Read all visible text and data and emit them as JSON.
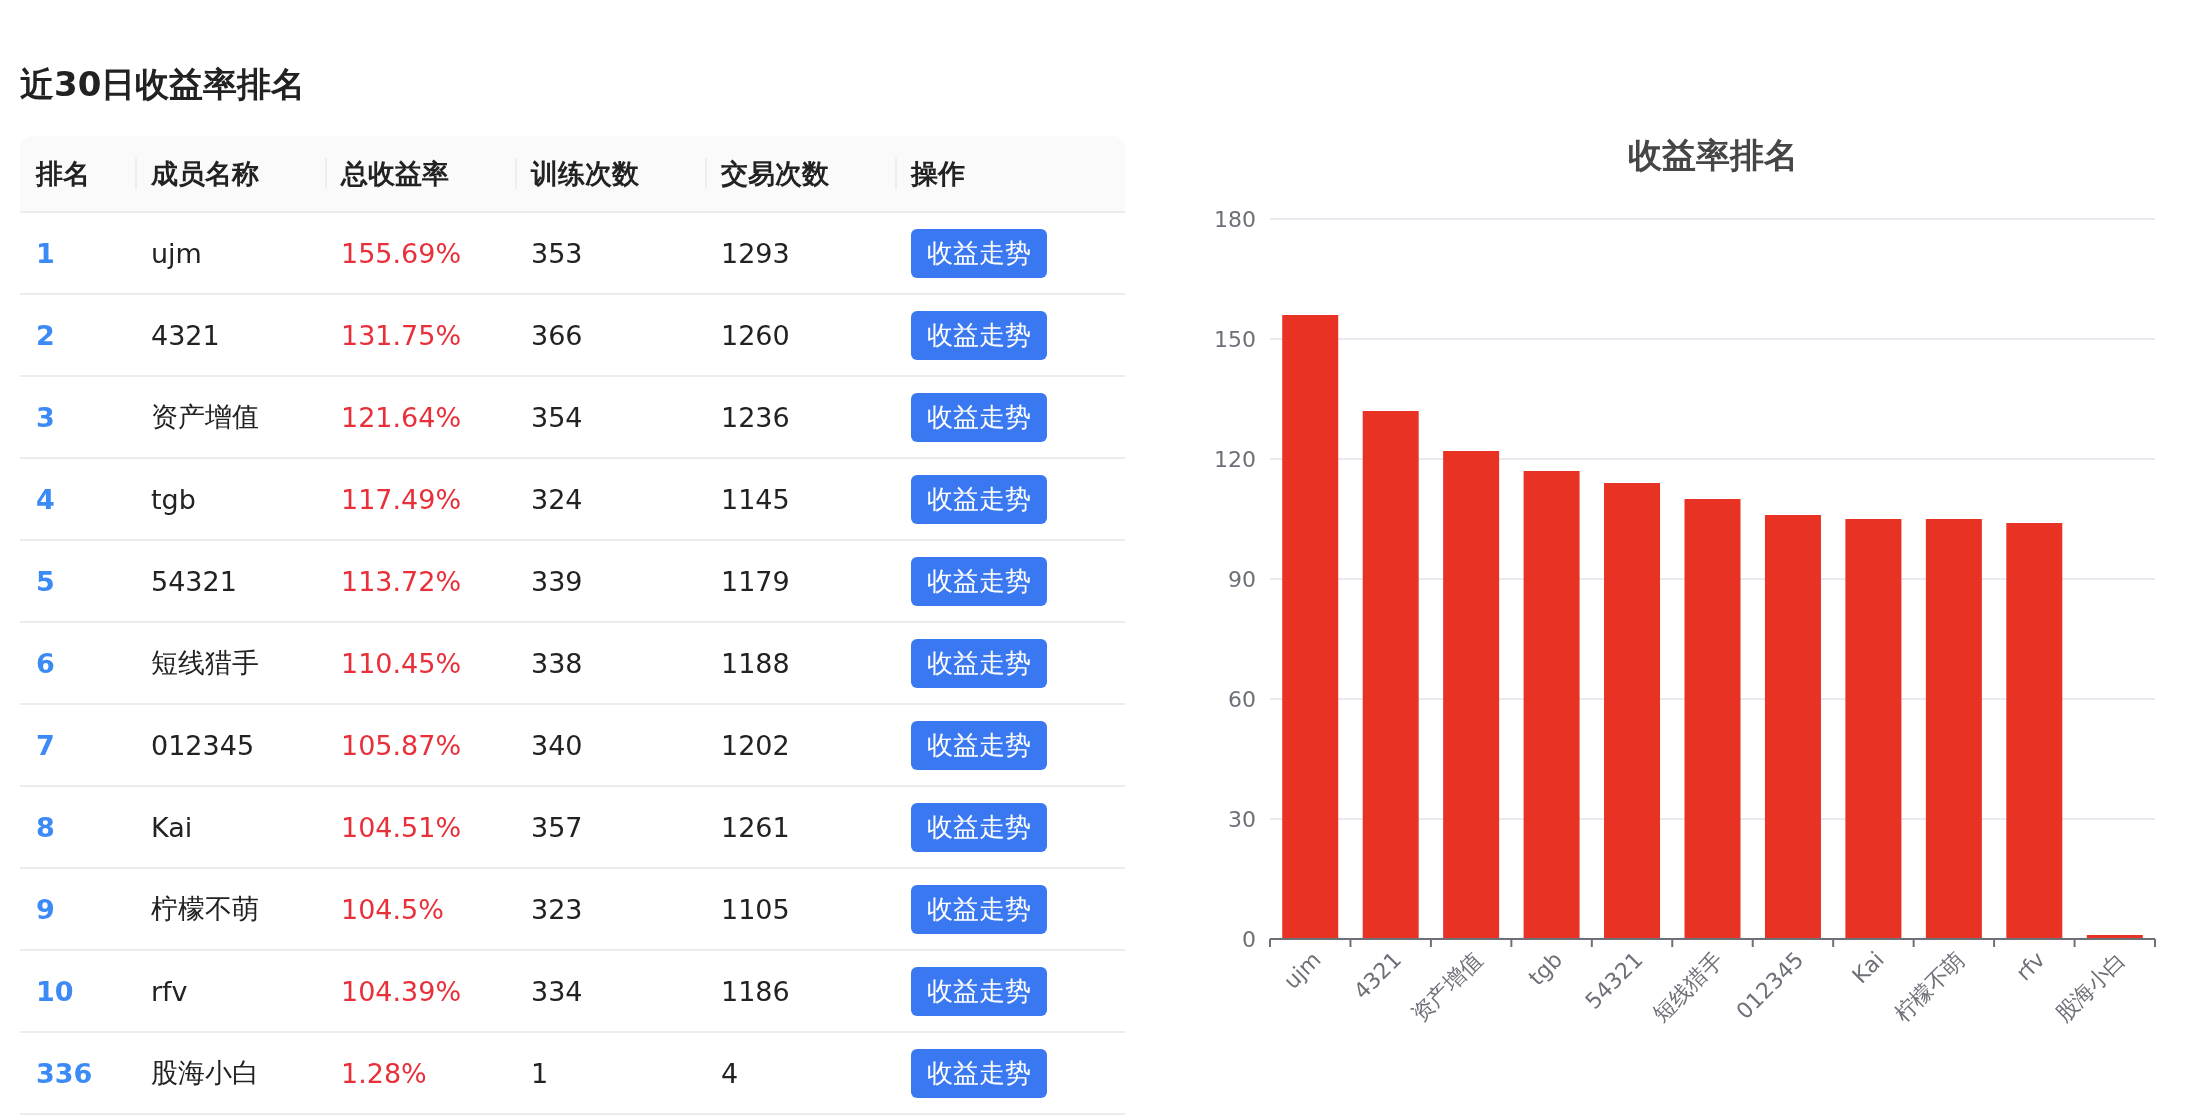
{
  "title": "近30日收益率排名",
  "table": {
    "columns": [
      "排名",
      "成员名称",
      "总收益率",
      "训练次数",
      "交易次数",
      "操作"
    ],
    "rows": [
      {
        "rank": "1",
        "name": "ujm",
        "rate": "155.69%",
        "training": "353",
        "trades": "1293",
        "action": "收益走势"
      },
      {
        "rank": "2",
        "name": "4321",
        "rate": "131.75%",
        "training": "366",
        "trades": "1260",
        "action": "收益走势"
      },
      {
        "rank": "3",
        "name": "资产增值",
        "rate": "121.64%",
        "training": "354",
        "trades": "1236",
        "action": "收益走势"
      },
      {
        "rank": "4",
        "name": "tgb",
        "rate": "117.49%",
        "training": "324",
        "trades": "1145",
        "action": "收益走势"
      },
      {
        "rank": "5",
        "name": "54321",
        "rate": "113.72%",
        "training": "339",
        "trades": "1179",
        "action": "收益走势"
      },
      {
        "rank": "6",
        "name": "短线猎手",
        "rate": "110.45%",
        "training": "338",
        "trades": "1188",
        "action": "收益走势"
      },
      {
        "rank": "7",
        "name": "012345",
        "rate": "105.87%",
        "training": "340",
        "trades": "1202",
        "action": "收益走势"
      },
      {
        "rank": "8",
        "name": "Kai",
        "rate": "104.51%",
        "training": "357",
        "trades": "1261",
        "action": "收益走势"
      },
      {
        "rank": "9",
        "name": "柠檬不萌",
        "rate": "104.5%",
        "training": "323",
        "trades": "1105",
        "action": "收益走势"
      },
      {
        "rank": "10",
        "name": "rfv",
        "rate": "104.39%",
        "training": "334",
        "trades": "1186",
        "action": "收益走势"
      },
      {
        "rank": "336",
        "name": "股海小白",
        "rate": "1.28%",
        "training": "1",
        "trades": "4",
        "action": "收益走势"
      }
    ]
  },
  "chart": {
    "chart_data": {
      "type": "bar",
      "title": "收益率排名",
      "categories": [
        "ujm",
        "4321",
        "资产增值",
        "tgb",
        "54321",
        "短线猎手",
        "012345",
        "Kai",
        "柠檬不萌",
        "rfv",
        "股海小白"
      ],
      "series": [
        {
          "color": "#e83324",
          "values": [
            156,
            132,
            122,
            117,
            114,
            110,
            106,
            105,
            105,
            104,
            1
          ]
        }
      ],
      "grid": true,
      "ylim": [
        0,
        180
      ],
      "yticks": [
        0,
        30,
        60,
        90,
        120,
        150,
        180
      ]
    }
  }
}
